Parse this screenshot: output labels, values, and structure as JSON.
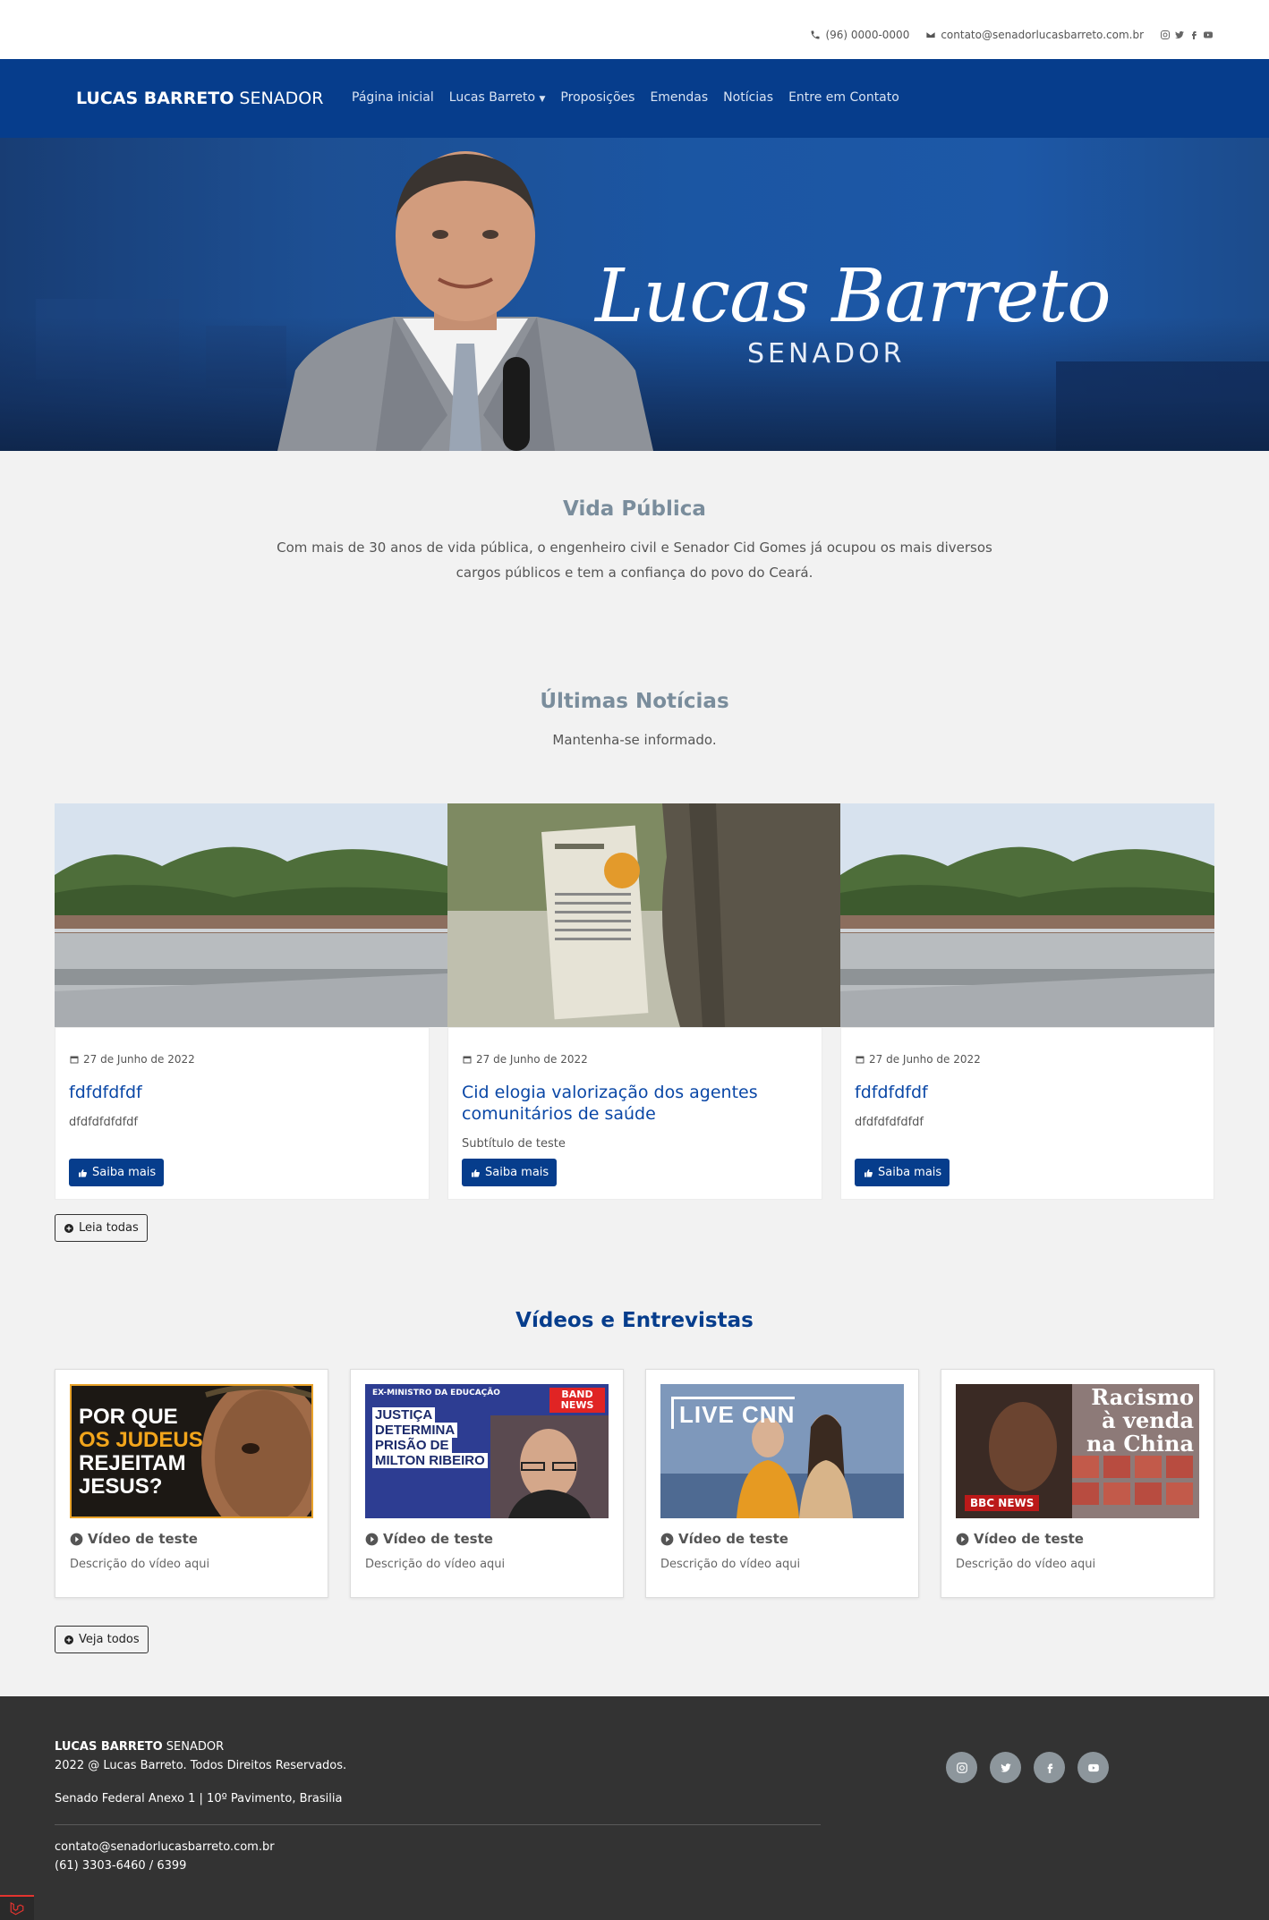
{
  "topbar": {
    "phone": "(96) 0000-0000",
    "email": "contato@senadorlucasbarreto.com.br",
    "socials": [
      "instagram-icon",
      "twitter-icon",
      "facebook-icon",
      "youtube-icon"
    ]
  },
  "navbar": {
    "brand_bold": "LUCAS BARRETO",
    "brand_light": "SENADOR",
    "links": [
      "Página inicial",
      "Lucas Barreto",
      "Proposições",
      "Emendas",
      "Notícias",
      "Entre em Contato"
    ]
  },
  "hero": {
    "name": "Lucas Barreto",
    "subtitle": "SENADOR"
  },
  "vida": {
    "title": "Vida Pública",
    "text": "Com mais de 30 anos de vida pública, o engenheiro civil e Senador Cid Gomes já ocupou os mais diversos cargos públicos e tem a confiança do povo do Ceará."
  },
  "news": {
    "title": "Últimas Notícias",
    "subtitle": "Mantenha-se informado.",
    "items": [
      {
        "date": "27 de Junho de 2022",
        "title": "fdfdfdfdf",
        "subtitle": "dfdfdfdfdfdf",
        "button": "Saiba mais"
      },
      {
        "date": "27 de Junho de 2022",
        "title": "Cid elogia valorização dos agentes comunitários de saúde",
        "subtitle": "Subtítulo de teste",
        "button": "Saiba mais"
      },
      {
        "date": "27 de Junho de 2022",
        "title": "fdfdfdfdf",
        "subtitle": "dfdfdfdfdfdf",
        "button": "Saiba mais"
      }
    ],
    "more_button": "Leia todas"
  },
  "videos": {
    "title": "Vídeos e Entrevistas",
    "items": [
      {
        "title": "Vídeo de teste",
        "description": "Descrição do vídeo aqui",
        "thumb_lines": [
          "POR QUE",
          "OS JUDEUS",
          "REJEITAM",
          "JESUS?"
        ]
      },
      {
        "title": "Vídeo de teste",
        "description": "Descrição do vídeo aqui",
        "thumb_kicker": "EX-MINISTRO DA EDUCAÇÃO",
        "thumb_lines": [
          "JUSTIÇA",
          "DETERMINA",
          "PRISÃO DE",
          "MILTON RIBEIRO"
        ],
        "thumb_badge": "BAND NEWS"
      },
      {
        "title": "Vídeo de teste",
        "description": "Descrição do vídeo aqui",
        "thumb_badge": "LIVE CNN"
      },
      {
        "title": "Vídeo de teste",
        "description": "Descrição do vídeo aqui",
        "thumb_lines": [
          "Racismo",
          "à venda",
          "na China"
        ],
        "thumb_badge": "BBC NEWS"
      }
    ],
    "more_button": "Veja todos"
  },
  "footer": {
    "brand_bold": "LUCAS BARRETO",
    "brand_light": "SENADOR",
    "copyright": "2022 @ Lucas Barreto. Todos Direitos Reservados.",
    "address": "Senado Federal Anexo 1 | 10º Pavimento, Brasilia",
    "email": "contato@senadorlucasbarreto.com.br",
    "phone": "(61) 3303-6460 / 6399"
  },
  "colors": {
    "navy": "#063d8c",
    "link_blue": "#0a47a6",
    "footer_bg": "#333333",
    "title_gray": "#7a8d9c"
  }
}
